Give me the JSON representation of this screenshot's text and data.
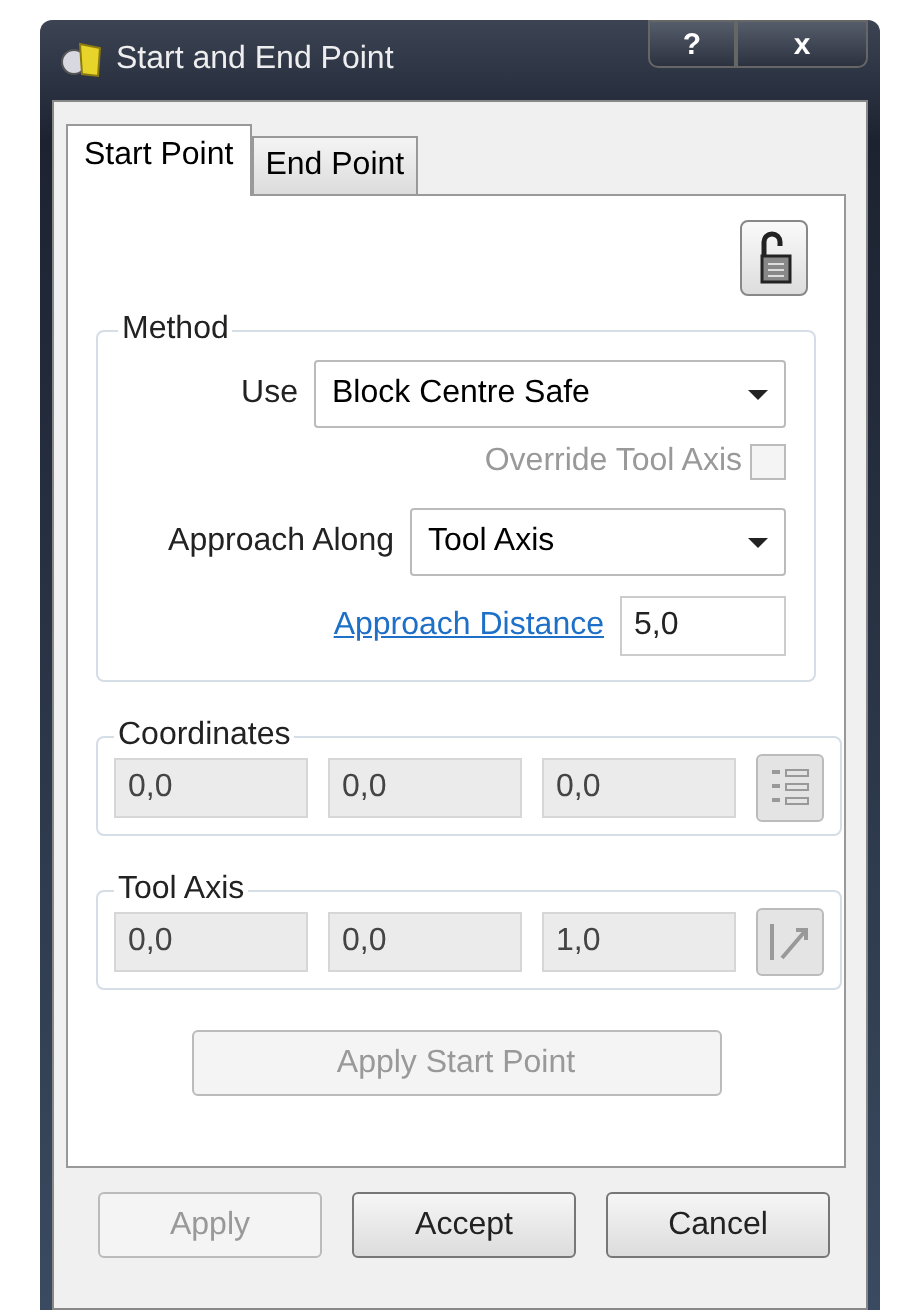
{
  "window": {
    "title": "Start and End Point"
  },
  "title_buttons": [
    {
      "kind": "help",
      "label": "?"
    },
    {
      "kind": "close",
      "label": "x"
    }
  ],
  "tabs": [
    {
      "label": "Start Point",
      "selected": true
    },
    {
      "label": "End Point",
      "selected": false
    }
  ],
  "method": {
    "title": "Method",
    "use": {
      "label": "Use",
      "value": "Block Centre Safe"
    },
    "override": {
      "label": "Override Tool Axis",
      "checked": false,
      "disabled": true
    },
    "approach_along": {
      "label": "Approach Along",
      "value": "Tool Axis"
    },
    "approach_distance": {
      "label": "Approach Distance",
      "value": "5,0"
    }
  },
  "coordinates": {
    "title": "Coordinates",
    "values": [
      "0,0",
      "0,0",
      "0,0"
    ],
    "disabled": true
  },
  "tool_axis": {
    "title": "Tool Axis",
    "values": [
      "0,0",
      "0,0",
      "1,0"
    ],
    "disabled": true
  },
  "apply_start_point": {
    "label": "Apply Start Point",
    "disabled": true
  },
  "buttons": [
    {
      "label": "Apply",
      "disabled": true
    },
    {
      "label": "Accept",
      "disabled": false
    },
    {
      "label": "Cancel",
      "disabled": false
    }
  ]
}
